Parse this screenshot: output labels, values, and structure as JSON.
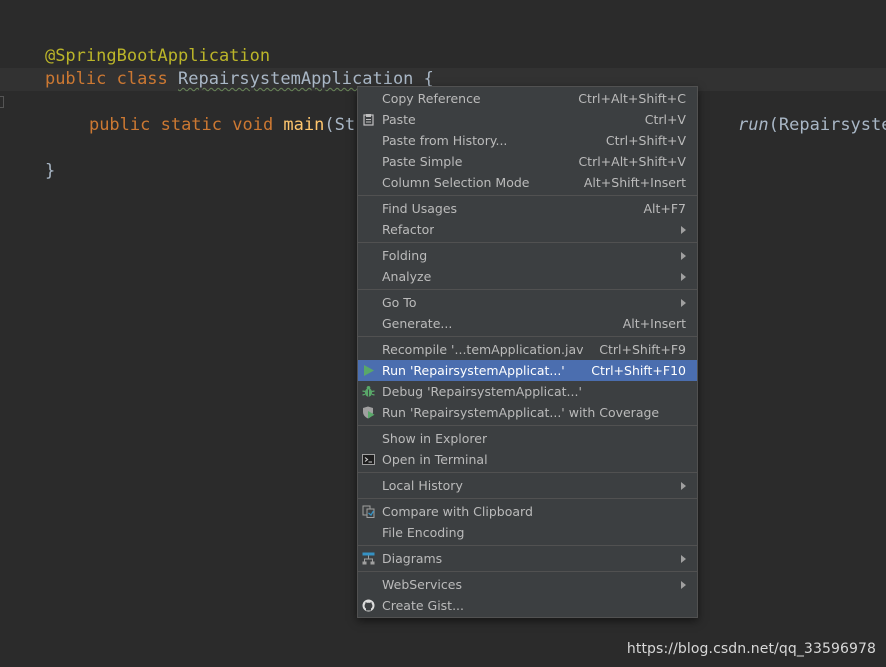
{
  "editor": {
    "line1": "@SpringBootApplication",
    "line2_kw": "public class ",
    "line2_cls": "RepairsystemApplication",
    "line2_end": " {",
    "line3_kw": "public static void ",
    "line3_fn": "main",
    "line3_rest": "(Stri",
    "line3_right_it": "run",
    "line3_right_rest": "(RepairsystemAp",
    "line4": "}"
  },
  "menu": {
    "items": [
      {
        "label": "Copy Reference",
        "shortcut": "Ctrl+Alt+Shift+C"
      },
      {
        "label": "Paste",
        "shortcut": "Ctrl+V",
        "icon": "clipboard-icon"
      },
      {
        "label": "Paste from History...",
        "shortcut": "Ctrl+Shift+V"
      },
      {
        "label": "Paste Simple",
        "shortcut": "Ctrl+Alt+Shift+V"
      },
      {
        "label": "Column Selection Mode",
        "shortcut": "Alt+Shift+Insert"
      },
      {
        "label": "Find Usages",
        "shortcut": "Alt+F7"
      },
      {
        "label": "Refactor"
      },
      {
        "label": "Folding"
      },
      {
        "label": "Analyze"
      },
      {
        "label": "Go To"
      },
      {
        "label": "Generate...",
        "shortcut": "Alt+Insert"
      },
      {
        "label": "Recompile '...temApplication.java'",
        "shortcut": "Ctrl+Shift+F9"
      },
      {
        "label": "Run 'RepairsystemApplicat...'",
        "shortcut": "Ctrl+Shift+F10",
        "icon": "run-icon"
      },
      {
        "label": "Debug 'RepairsystemApplicat...'",
        "icon": "debug-bug-icon"
      },
      {
        "label": "Run 'RepairsystemApplicat...' with Coverage",
        "icon": "coverage-shield-icon"
      },
      {
        "label": "Show in Explorer"
      },
      {
        "label": "Open in Terminal",
        "icon": "terminal-icon"
      },
      {
        "label": "Local History"
      },
      {
        "label": "Compare with Clipboard",
        "icon": "compare-icon"
      },
      {
        "label": "File Encoding"
      },
      {
        "label": "Diagrams",
        "icon": "diagram-icon"
      },
      {
        "label": "WebServices"
      },
      {
        "label": "Create Gist...",
        "icon": "github-icon"
      }
    ]
  },
  "colors": {
    "editor_bg": "#2b2b2b",
    "menu_bg": "#3c3f41",
    "selected_bg": "#4b6eaf",
    "annotation": "#bbb529",
    "keyword": "#cc7832",
    "function": "#ffc66d"
  },
  "watermark": "https://blog.csdn.net/qq_33596978"
}
